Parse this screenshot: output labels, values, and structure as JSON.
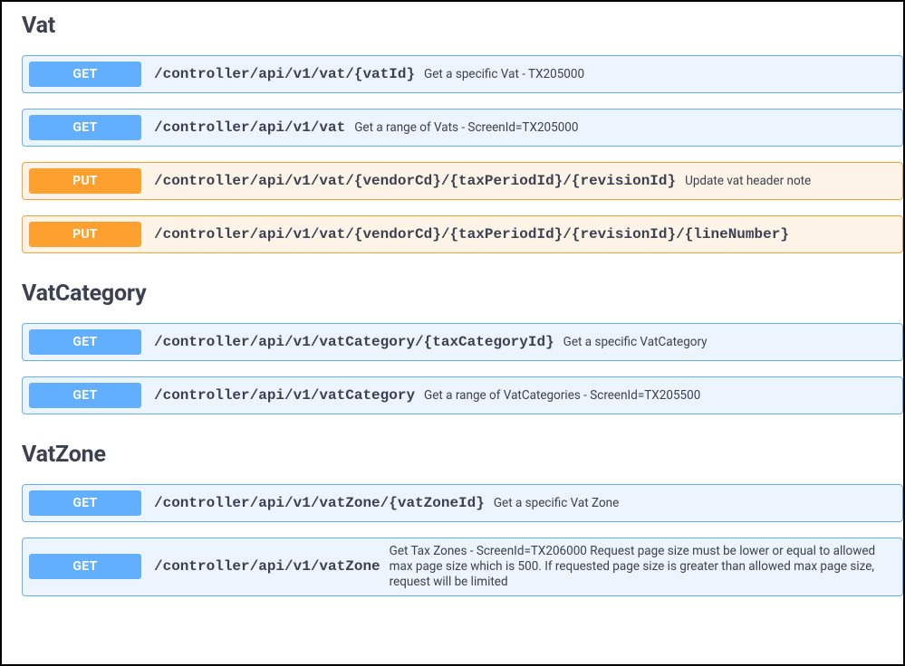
{
  "sections": [
    {
      "name": "Vat",
      "endpoints": [
        {
          "method": "GET",
          "path": "/controller/api/v1/vat/{vatId}",
          "summary": "Get a specific Vat - TX205000"
        },
        {
          "method": "GET",
          "path": "/controller/api/v1/vat",
          "summary": "Get a range of Vats - ScreenId=TX205000"
        },
        {
          "method": "PUT",
          "path": "/controller/api/v1/vat/{vendorCd}/{taxPeriodId}/{revisionId}",
          "summary": "Update vat header note"
        },
        {
          "method": "PUT",
          "path": "/controller/api/v1/vat/{vendorCd}/{taxPeriodId}/{revisionId}/{lineNumber}",
          "summary": ""
        }
      ]
    },
    {
      "name": "VatCategory",
      "endpoints": [
        {
          "method": "GET",
          "path": "/controller/api/v1/vatCategory/{taxCategoryId}",
          "summary": "Get a specific VatCategory"
        },
        {
          "method": "GET",
          "path": "/controller/api/v1/vatCategory",
          "summary": "Get a range of VatCategories - ScreenId=TX205500"
        }
      ]
    },
    {
      "name": "VatZone",
      "endpoints": [
        {
          "method": "GET",
          "path": "/controller/api/v1/vatZone/{vatZoneId}",
          "summary": "Get a specific Vat Zone"
        },
        {
          "method": "GET",
          "path": "/controller/api/v1/vatZone",
          "summary": "Get Tax Zones - ScreenId=TX206000 Request page size must be lower or equal to allowed max page size which is 500. If requested page size is greater than allowed max page size, request will be limited"
        }
      ]
    }
  ]
}
